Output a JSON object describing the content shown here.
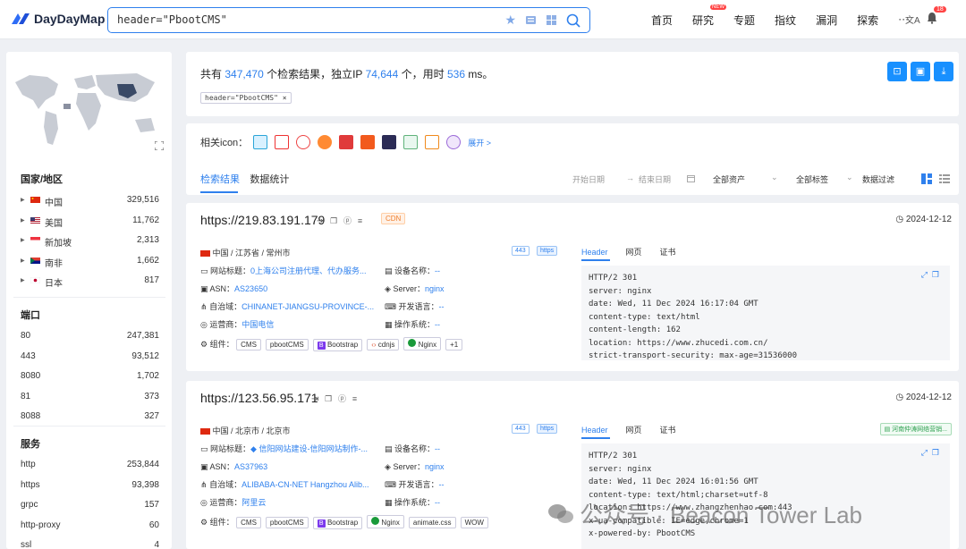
{
  "header": {
    "brand": "DayDayMap",
    "search_value": "header=\"PbootCMS\"",
    "nav": [
      "首页",
      "研究",
      "专题",
      "指纹",
      "漏洞",
      "探索",
      "···"
    ],
    "nav_new_badge": "NEW",
    "notify_count": "18"
  },
  "sidebar": {
    "country_title": "国家/地区",
    "countries": [
      {
        "name": "中国",
        "count": "329,516"
      },
      {
        "name": "美国",
        "count": "11,762"
      },
      {
        "name": "新加坡",
        "count": "2,313"
      },
      {
        "name": "南非",
        "count": "1,662"
      },
      {
        "name": "日本",
        "count": "817"
      }
    ],
    "port_title": "端口",
    "ports": [
      {
        "name": "80",
        "count": "247,381"
      },
      {
        "name": "443",
        "count": "93,512"
      },
      {
        "name": "8080",
        "count": "1,702"
      },
      {
        "name": "81",
        "count": "373"
      },
      {
        "name": "8088",
        "count": "327"
      }
    ],
    "service_title": "服务",
    "services": [
      {
        "name": "http",
        "count": "253,844"
      },
      {
        "name": "https",
        "count": "93,398"
      },
      {
        "name": "grpc",
        "count": "157"
      },
      {
        "name": "http-proxy",
        "count": "60"
      },
      {
        "name": "ssl",
        "count": "4"
      }
    ]
  },
  "summary": {
    "prefix": "共有",
    "total": "347,470",
    "mid1": "个检索结果，独立IP",
    "unique_ip": "74,644",
    "mid2": "个，用时",
    "time": "536",
    "suffix": "ms。",
    "query_tag": "header=\"PbootCMS\""
  },
  "related": {
    "label": "相关icon：",
    "expand": "展开 >",
    "tabs": [
      "检索结果",
      "数据统计"
    ],
    "start_date": "开始日期",
    "arrow": "→",
    "end_date": "结束日期",
    "all_assets": "全部资产",
    "all_tags": "全部标签",
    "data_filter": "数据过滤"
  },
  "labels": {
    "site_title": "网站标题：",
    "asn": "ASN：",
    "autonomous": "自治域：",
    "operator": "运营商：",
    "component": "组件：",
    "device": "设备名称：",
    "server": "Server：",
    "dev_lang": "开发语言：",
    "os": "操作系统：",
    "header_tab": "Header",
    "web_tab": "网页",
    "cert_tab": "证书"
  },
  "results": [
    {
      "ip": "https://219.83.191.179",
      "cdn": "CDN",
      "date": "2024-12-12",
      "location": "中国 / 江苏省 / 常州市",
      "port": "443",
      "proto": "https",
      "site_title": "0上海公司注册代理、代办服务...",
      "asn": "AS23650",
      "autonomous": "CHINANET-JIANGSU-PROVINCE-...",
      "operator": "中国电信",
      "device": "--",
      "server": "nginx",
      "dev_lang": "--",
      "os": "--",
      "components": [
        "CMS",
        "pbootCMS",
        "Bootstrap",
        "cdnjs",
        "Nginx",
        "+1"
      ],
      "headers": [
        "HTTP/2 301",
        "server: nginx",
        "date: Wed, 11 Dec 2024 16:17:04 GMT",
        "content-type: text/html",
        "content-length: 162",
        "location: https://www.zhucedi.com.cn/",
        "strict-transport-security: max-age=31536000"
      ]
    },
    {
      "ip": "https://123.56.95.171",
      "date": "2024-12-12",
      "location": "中国 / 北京市 / 北京市",
      "port": "443",
      "proto": "https",
      "tag_right": "河南仲涛网络营销...",
      "site_title": "信阳网站建设-信阳网站制作-...",
      "asn": "AS37963",
      "autonomous": "ALIBABA-CN-NET Hangzhou Alib...",
      "operator": "阿里云",
      "device": "--",
      "server": "nginx",
      "dev_lang": "--",
      "os": "--",
      "components": [
        "CMS",
        "pbootCMS",
        "Bootstrap",
        "Nginx",
        "animate.css",
        "WOW"
      ],
      "headers": [
        "HTTP/2 301",
        "server: nginx",
        "date: Wed, 11 Dec 2024 16:01:56 GMT",
        "content-type: text/html;charset=utf-8",
        "location: https://www.zhangzhenhao.com:443",
        "x-ua-compatible: IE=edge,chrome=1",
        "x-powered-by: PbootCMS"
      ]
    }
  ],
  "watermark": "公众号 · Beacon Tower Lab",
  "colors": {
    "accent": "#2f80ed",
    "cdn": "#f08030",
    "alert": "#ff4444"
  }
}
